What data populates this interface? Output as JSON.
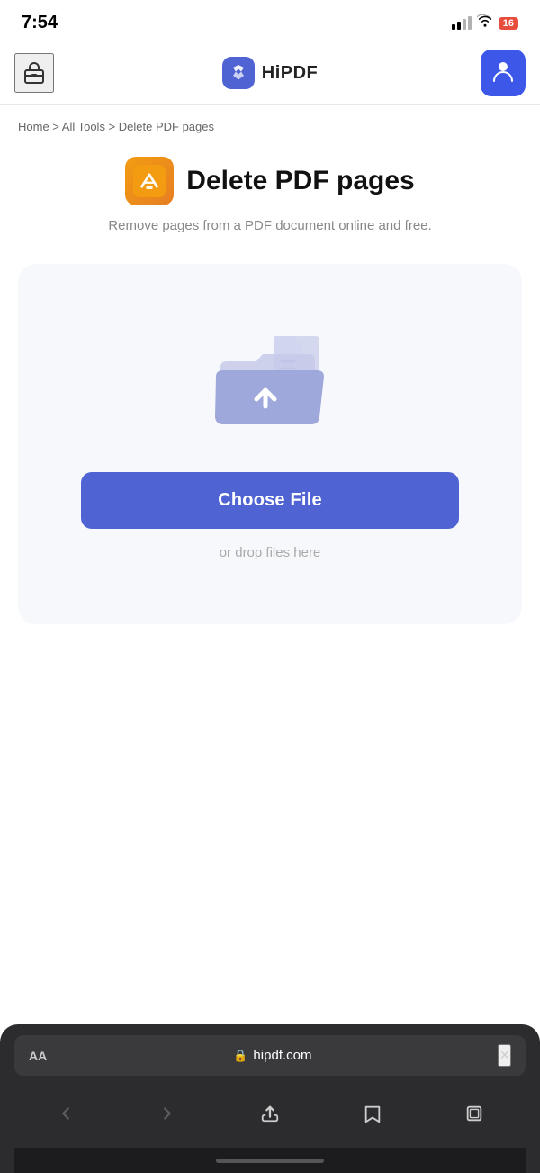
{
  "status_bar": {
    "time": "7:54",
    "battery_level": "16",
    "signal_label": "signal",
    "wifi_label": "wifi"
  },
  "navbar": {
    "toolbox_label": "toolbox",
    "brand_name": "HiPDF",
    "logo_label": "HiPDF logo",
    "user_label": "user account"
  },
  "breadcrumb": {
    "home": "Home",
    "separator1": " > ",
    "all_tools": "All Tools",
    "separator2": " > ",
    "current": "Delete PDF pages",
    "full_text": "Home > All Tools > Delete PDF pages"
  },
  "page": {
    "title": "Delete PDF pages",
    "subtitle": "Remove pages from a PDF document online and free.",
    "icon_label": "pdf-delete-icon"
  },
  "upload": {
    "choose_file_label": "Choose File",
    "drop_text": "or drop files here",
    "folder_icon_label": "upload-folder-icon"
  },
  "browser": {
    "font_size_label": "AA",
    "domain": "hipdf.com",
    "lock_icon": "🔒",
    "close_label": "×",
    "back_label": "back",
    "forward_label": "forward",
    "share_label": "share",
    "bookmarks_label": "bookmarks",
    "tabs_label": "tabs"
  }
}
